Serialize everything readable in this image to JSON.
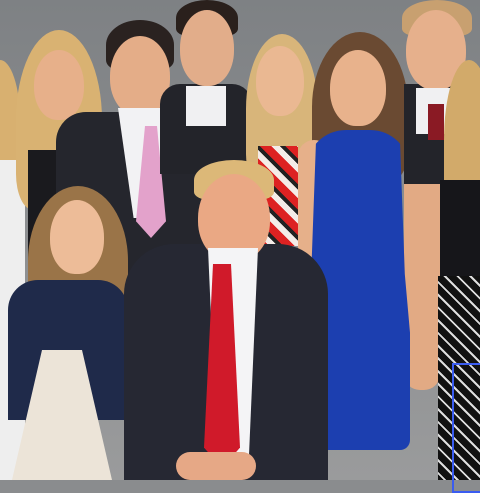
{
  "scene": {
    "kind": "group-photo",
    "colors": {
      "background": "#8a8c8e",
      "blue_dress": "#1c3fb0",
      "suit": "#22232b",
      "red_tie": "#d01a2a",
      "pink_tie": "#e0a0c8",
      "skin": "#e8b48e",
      "blonde_hair": "#d9b070",
      "selection_box": "#3a5cf0"
    }
  }
}
